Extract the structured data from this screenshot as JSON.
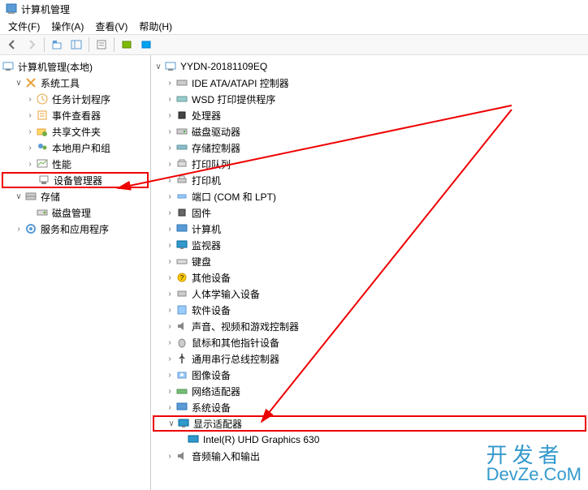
{
  "window_title": "计算机管理",
  "menu": [
    "文件(F)",
    "操作(A)",
    "查看(V)",
    "帮助(H)"
  ],
  "toolbar_icons": [
    "back",
    "forward",
    "up",
    "show-hide",
    "properties",
    "refresh",
    "help"
  ],
  "left_tree": {
    "root": "计算机管理(本地)",
    "system_tools": "系统工具",
    "task_scheduler": "任务计划程序",
    "event_viewer": "事件查看器",
    "shared_folders": "共享文件夹",
    "local_users": "本地用户和组",
    "performance": "性能",
    "device_manager": "设备管理器",
    "storage": "存储",
    "disk_management": "磁盘管理",
    "services_apps": "服务和应用程序"
  },
  "right_tree": {
    "computer": "YYDN-20181109EQ",
    "ide": "IDE ATA/ATAPI 控制器",
    "wsd": "WSD 打印提供程序",
    "cpu": "处理器",
    "disk_drives": "磁盘驱动器",
    "storage_ctrl": "存储控制器",
    "print_queue": "打印队列",
    "printers": "打印机",
    "ports": "端口 (COM 和 LPT)",
    "firmware": "固件",
    "computers": "计算机",
    "monitors": "监视器",
    "keyboards": "键盘",
    "other": "其他设备",
    "hid": "人体学输入设备",
    "software": "软件设备",
    "sound": "声音、视频和游戏控制器",
    "mouse": "鼠标和其他指针设备",
    "usb": "通用串行总线控制器",
    "imaging": "图像设备",
    "network": "网络适配器",
    "system": "系统设备",
    "display": "显示适配器",
    "display_child": "Intel(R) UHD Graphics 630",
    "audio_io": "音频输入和输出"
  },
  "watermark": {
    "line1": "开发者",
    "line2": "DevZe.CoM"
  }
}
